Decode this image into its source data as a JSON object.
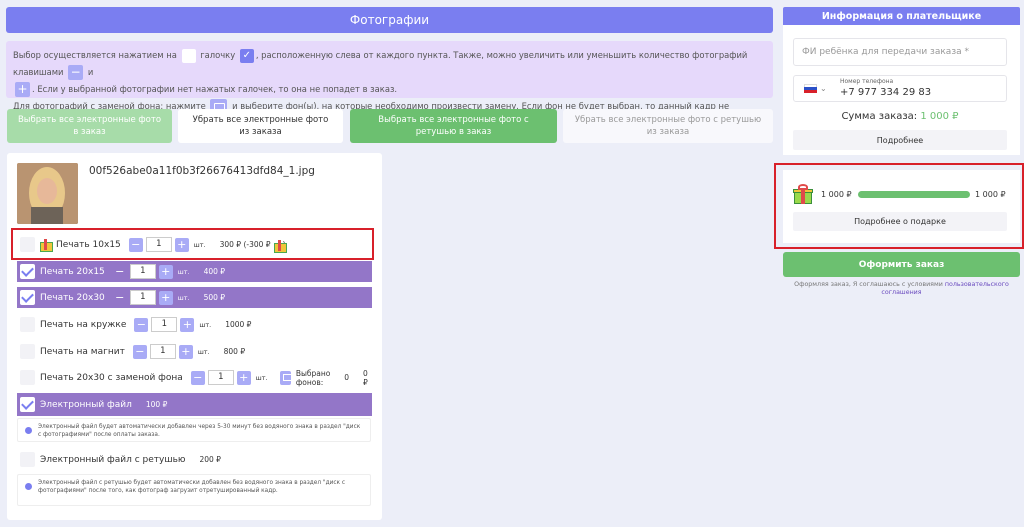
{
  "header": {
    "title": "Фотографии"
  },
  "info": {
    "line1_a": "Выбор осуществляется нажатием на",
    "line1_b": "галочку",
    "line1_c": ", расположенную слева от каждого пункта. Также, можно увеличить или уменьшить количество фотографий клавишами",
    "line1_d": "и",
    "line2": ". Если у выбранной фотографии нет нажатых галочек, то она не попадет в заказ.",
    "line3_a": "Для фотографий с заменой фона: нажмите",
    "line3_b": "и выберите фон(ы), на которые необходимо произвести замену. Если фон не будет выбран, то данный кадр не попадет в заказ.",
    "minus_icon": "−",
    "plus_icon": "+",
    "check_icon": "✓"
  },
  "actions": {
    "select_all_electronic": "Выбрать все электронные фото в заказ",
    "remove_all_electronic": "Убрать все электронные фото из заказа",
    "select_all_retouch": "Выбрать все электронные фото с ретушью в заказ",
    "remove_all_retouch": "Убрать все электронные фото с ретушью из заказа"
  },
  "photo": {
    "filename": "00f526abe0a11f0b3f26676413dfd84_1.jpg"
  },
  "products": [
    {
      "label": "Печать 10x15",
      "checked": false,
      "qty": "1",
      "unit": "шт.",
      "price": "300 ₽ (-300 ₽",
      "price_suffix": ")",
      "gift": true
    },
    {
      "label": "Печать 20x15",
      "checked": true,
      "qty": "1",
      "unit": "шт.",
      "price": "400 ₽"
    },
    {
      "label": "Печать 20x30",
      "checked": true,
      "qty": "1",
      "unit": "шт.",
      "price": "500 ₽"
    },
    {
      "label": "Печать на кружке",
      "checked": false,
      "qty": "1",
      "unit": "шт.",
      "price": "1000 ₽"
    },
    {
      "label": "Печать на магнит",
      "checked": false,
      "qty": "1",
      "unit": "шт.",
      "price": "800 ₽"
    },
    {
      "label": "Печать 20x30 с заменой фона",
      "checked": false,
      "qty": "1",
      "unit": "шт.",
      "bg_label": "Выбрано фонов:",
      "bg_count": "0",
      "price": "0 ₽"
    },
    {
      "label": "Электронный файл",
      "checked": true,
      "price": "100 ₽",
      "note": "Электронный файл будет автоматически добавлен через 5-30 минут без водяного знака в раздел \"диск с фотографиями\" после оплаты заказа."
    },
    {
      "label": "Электронный файл с ретушью",
      "checked": false,
      "price": "200 ₽",
      "note": "Электронный файл с ретушью будет автоматически добавлен без водяного знака в раздел \"диск с фотографиями\" после того, как фотограф загрузит отретушированный кадр."
    }
  ],
  "payer": {
    "title": "Информация о плательщике",
    "child_name_placeholder": "ФИ ребёнка для передачи заказа *",
    "phone_label": "Номер телефона",
    "phone_value": "+7 977 334 29 83",
    "sum_label": "Сумма заказа:",
    "sum_value": "1 000 ₽",
    "details_button": "Подробнее"
  },
  "gift": {
    "left_amount": "1 000 ₽",
    "right_amount": "1 000 ₽",
    "progress": 1.0,
    "details_button": "Подробнее о подарке"
  },
  "order": {
    "button": "Оформить заказ",
    "agree_text": "Оформляя заказ, Я соглашаюсь с условиями",
    "agree_link": "пользовательского соглашения"
  },
  "colors": {
    "accent": "#7a7ef0",
    "purple_row": "#9376c8",
    "green": "#6cc070",
    "highlight": "#d8202a"
  }
}
